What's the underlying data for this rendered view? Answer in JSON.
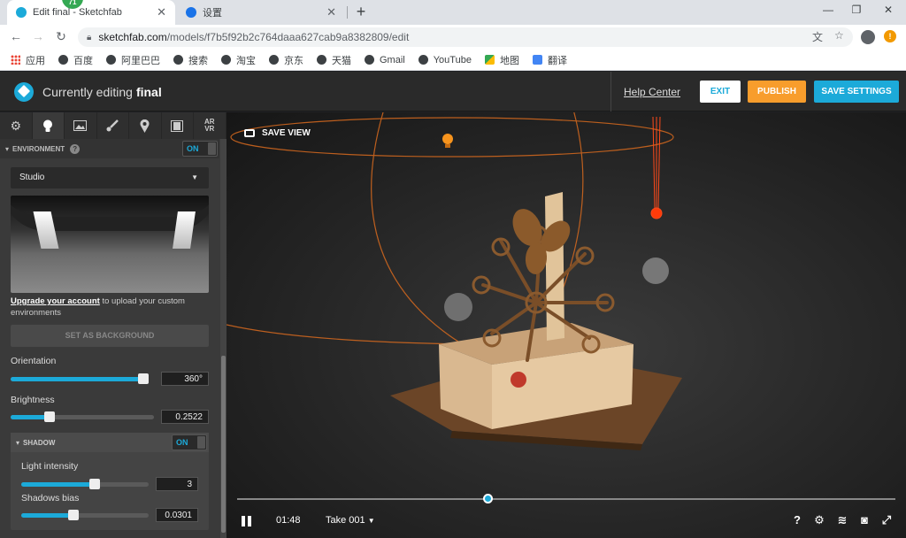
{
  "browser": {
    "tabs": [
      {
        "label": "Edit final - Sketchfab",
        "favicon_color": "#1caad9",
        "active": true
      },
      {
        "label": "设置",
        "favicon_color": "#1a73e8",
        "active": false
      }
    ],
    "notification_badge": "71",
    "url_host": "sketchfab.com",
    "url_path": "/models/f7b5f92b2c764daaa627cab9a8382809/edit",
    "bookmarks": [
      "应用",
      "百度",
      "阿里巴巴",
      "搜索",
      "淘宝",
      "京东",
      "天猫",
      "Gmail",
      "YouTube",
      "地图",
      "翻译"
    ]
  },
  "header": {
    "editing_prefix": "Currently editing",
    "model_name": "final",
    "help_center": "Help Center",
    "exit": "EXIT",
    "publish": "PUBLISH",
    "save_settings": "SAVE SETTINGS",
    "colors": {
      "accent": "#1caad9",
      "publish": "#f89d2c"
    }
  },
  "panel": {
    "tab_icons": [
      "gear-icon",
      "lightbulb-icon",
      "image-icon",
      "brush-icon",
      "pin-icon",
      "film-icon",
      "ar-vr-icon"
    ],
    "arvr_label_top": "AR",
    "arvr_label_bottom": "VR",
    "environment": {
      "title": "ENVIRONMENT",
      "toggle": "ON",
      "preset": "Studio",
      "upgrade_link": "Upgrade your account",
      "upgrade_text": " to upload your custom environments",
      "set_background": "SET AS BACKGROUND",
      "orientation": {
        "label": "Orientation",
        "value": "360°",
        "fraction": 1.0
      },
      "brightness": {
        "label": "Brightness",
        "value": "0.2522",
        "fraction": 0.28
      }
    },
    "shadow": {
      "title": "SHADOW",
      "toggle": "ON",
      "light_intensity": {
        "label": "Light intensity",
        "value": "3",
        "fraction": 0.6
      },
      "shadows_bias": {
        "label": "Shadows bias",
        "value": "0.0301",
        "fraction": 0.43
      }
    }
  },
  "viewport": {
    "save_view": "SAVE VIEW",
    "timecode": "01:48",
    "take": "Take 001",
    "timeline_fraction": 0.38,
    "right_icons": [
      "help-icon",
      "settings-icon",
      "layers-icon",
      "vr-icon",
      "fullscreen-icon"
    ],
    "help_glyph": "?"
  }
}
